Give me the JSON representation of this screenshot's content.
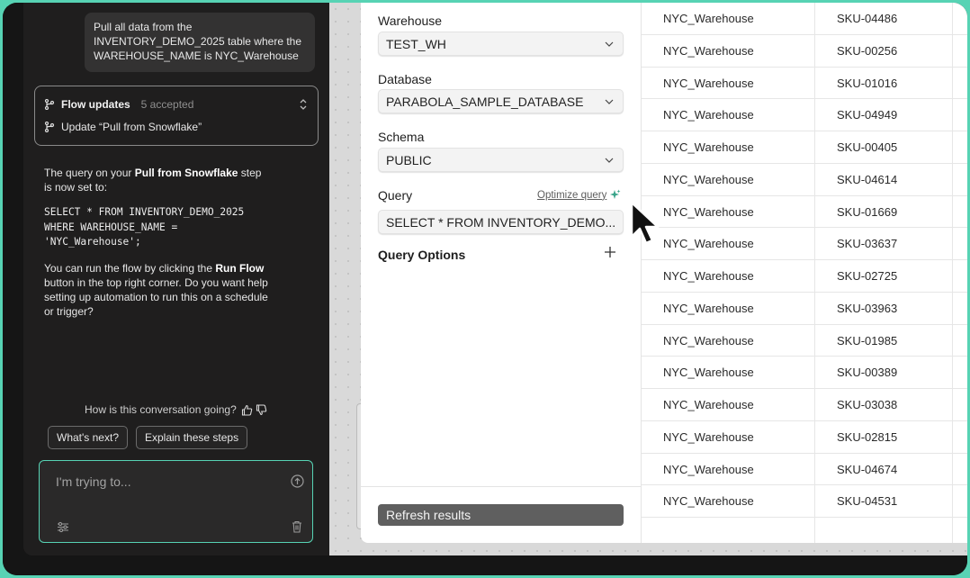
{
  "chat": {
    "user_message": "Pull all data from the INVENTORY_DEMO_2025 table where the WAREHOUSE_NAME is NYC_Warehouse",
    "flow_updates": {
      "title": "Flow updates",
      "count": "5 accepted",
      "item": "Update “Pull from Snowflake”"
    },
    "assistant": {
      "p1_prefix": "The query on your ",
      "p1_bold": "Pull from Snowflake",
      "p1_suffix": " step is now set to:",
      "code": "SELECT * FROM INVENTORY_DEMO_2025\nWHERE WAREHOUSE_NAME =\n'NYC_Warehouse';",
      "p2_prefix": "You can run the flow by clicking the ",
      "p2_bold": "Run Flow",
      "p2_suffix": " button in the top right corner. Do you want help setting up automation to run this on a schedule or trigger?"
    },
    "feedback_prompt": "How is this conversation going?",
    "suggestions": [
      "What's next?",
      "Explain these steps"
    ],
    "input_placeholder": "I'm trying to..."
  },
  "settings": {
    "warehouse_label": "Warehouse",
    "warehouse_value": "TEST_WH",
    "database_label": "Database",
    "database_value": "PARABOLA_SAMPLE_DATABASE",
    "schema_label": "Schema",
    "schema_value": "PUBLIC",
    "query_label": "Query",
    "optimize_label": "Optimize query",
    "query_value": "SELECT * FROM INVENTORY_DEMO...",
    "query_options_label": "Query Options",
    "refresh_label": "Refresh results"
  },
  "table": {
    "rows": [
      [
        "NYC_Warehouse",
        "SKU-04486"
      ],
      [
        "NYC_Warehouse",
        "SKU-00256"
      ],
      [
        "NYC_Warehouse",
        "SKU-01016"
      ],
      [
        "NYC_Warehouse",
        "SKU-04949"
      ],
      [
        "NYC_Warehouse",
        "SKU-00405"
      ],
      [
        "NYC_Warehouse",
        "SKU-04614"
      ],
      [
        "NYC_Warehouse",
        "SKU-01669"
      ],
      [
        "NYC_Warehouse",
        "SKU-03637"
      ],
      [
        "NYC_Warehouse",
        "SKU-02725"
      ],
      [
        "NYC_Warehouse",
        "SKU-03963"
      ],
      [
        "NYC_Warehouse",
        "SKU-01985"
      ],
      [
        "NYC_Warehouse",
        "SKU-00389"
      ],
      [
        "NYC_Warehouse",
        "SKU-03038"
      ],
      [
        "NYC_Warehouse",
        "SKU-02815"
      ],
      [
        "NYC_Warehouse",
        "SKU-04674"
      ],
      [
        "NYC_Warehouse",
        "SKU-04531"
      ]
    ]
  },
  "colors": {
    "accent": "#57d3b4",
    "chat_bg": "#1f1e1e",
    "refresh_button": "#5f5f5f"
  }
}
